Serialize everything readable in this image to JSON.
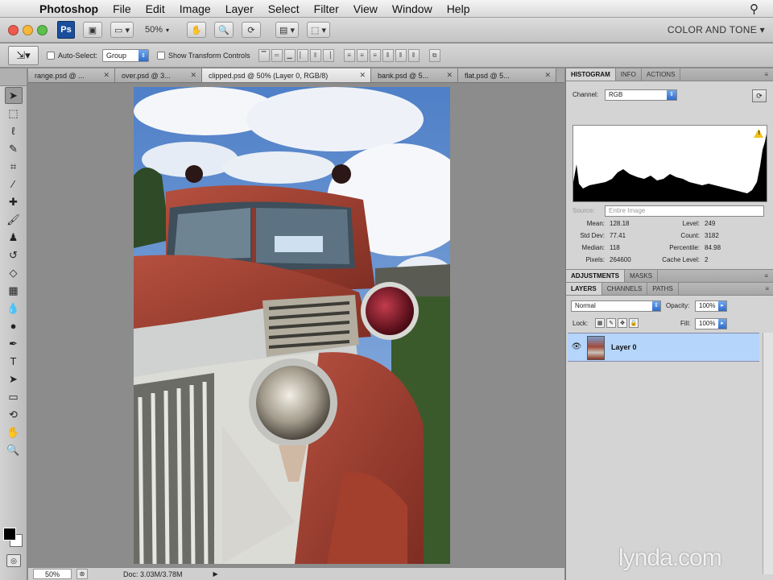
{
  "menubar": {
    "app": "Photoshop",
    "items": [
      "File",
      "Edit",
      "Image",
      "Layer",
      "Select",
      "Filter",
      "View",
      "Window",
      "Help"
    ]
  },
  "appbar": {
    "logo": "Ps",
    "zoom": "50%",
    "workspace": "COLOR AND TONE ▾"
  },
  "options": {
    "auto_select_label": "Auto-Select:",
    "auto_select_value": "Group",
    "show_transform_label": "Show Transform Controls"
  },
  "tabs": [
    {
      "label": "range.psd @ ...",
      "active": false
    },
    {
      "label": "over.psd @ 3...",
      "active": false
    },
    {
      "label": "clipped.psd @ 50% (Layer 0, RGB/8)",
      "active": true
    },
    {
      "label": "bank.psd @ 5...",
      "active": false
    },
    {
      "label": "flat.psd @ 5...",
      "active": false
    }
  ],
  "statusbar": {
    "zoom": "50%",
    "doc": "Doc: 3.03M/3.78M"
  },
  "histogram_panel": {
    "tabs": [
      "HISTOGRAM",
      "INFO",
      "ACTIONS"
    ],
    "channel_label": "Channel:",
    "channel_value": "RGB",
    "source_label": "Source:",
    "source_value": "Entire Image",
    "stats_left": [
      {
        "k": "Mean:",
        "v": "128.18"
      },
      {
        "k": "Std Dev:",
        "v": "77.41"
      },
      {
        "k": "Median:",
        "v": "118"
      },
      {
        "k": "Pixels:",
        "v": "264600"
      }
    ],
    "stats_right": [
      {
        "k": "Level:",
        "v": "249"
      },
      {
        "k": "Count:",
        "v": "3182"
      },
      {
        "k": "Percentile:",
        "v": "84.98"
      },
      {
        "k": "Cache Level:",
        "v": "2"
      }
    ]
  },
  "adjustments_panel": {
    "tabs": [
      "ADJUSTMENTS",
      "MASKS"
    ]
  },
  "layers_panel": {
    "tabs": [
      "LAYERS",
      "CHANNELS",
      "PATHS"
    ],
    "blend_mode": "Normal",
    "opacity_label": "Opacity:",
    "opacity_value": "100%",
    "lock_label": "Lock:",
    "fill_label": "Fill:",
    "fill_value": "100%",
    "layer_name": "Layer 0"
  },
  "watermark": "lynda.com"
}
